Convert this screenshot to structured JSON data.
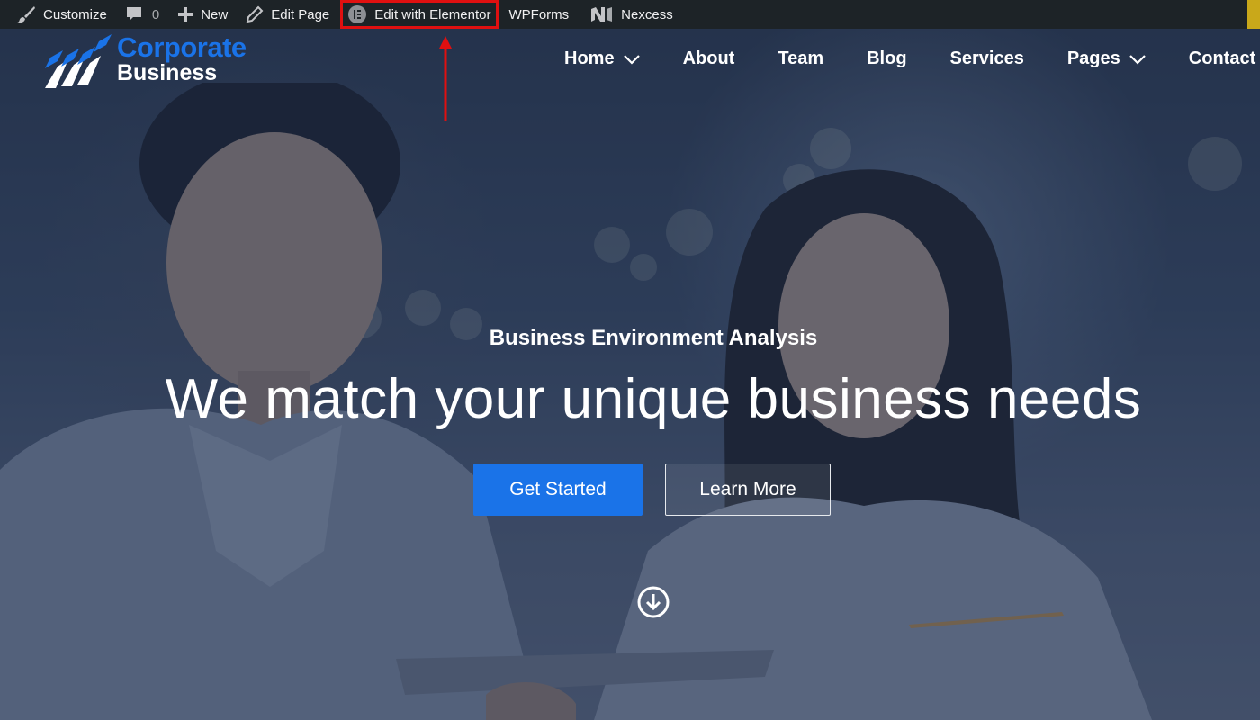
{
  "adminbar": {
    "customize": "Customize",
    "comments_count": "0",
    "new": "New",
    "edit_page": "Edit Page",
    "edit_elementor": "Edit with Elementor",
    "wpforms": "WPForms",
    "nexcess": "Nexcess"
  },
  "logo": {
    "line1": "Corporate",
    "line2": "Business"
  },
  "nav": {
    "items": [
      {
        "label": "Home",
        "has_dropdown": true
      },
      {
        "label": "About",
        "has_dropdown": false
      },
      {
        "label": "Team",
        "has_dropdown": false
      },
      {
        "label": "Blog",
        "has_dropdown": false
      },
      {
        "label": "Services",
        "has_dropdown": false
      },
      {
        "label": "Pages",
        "has_dropdown": true
      },
      {
        "label": "Contact",
        "has_dropdown": false
      }
    ]
  },
  "hero": {
    "eyebrow": "Business Environment Analysis",
    "headline": "We match your unique business needs",
    "primary_button": "Get Started",
    "secondary_button": "Learn More"
  },
  "icons": {
    "customize": "paintbrush-icon",
    "comments": "speech-bubble-icon",
    "new": "plus-icon",
    "edit_page": "pencil-icon",
    "elementor": "elementor-logo-icon",
    "nexcess": "nexcess-logo-icon",
    "chevron": "chevron-down-icon",
    "scroll": "arrow-down-circle-icon"
  },
  "colors": {
    "adminbar_bg": "#1d2327",
    "brand_blue": "#1a73e8",
    "annotation_red": "#e01010"
  }
}
